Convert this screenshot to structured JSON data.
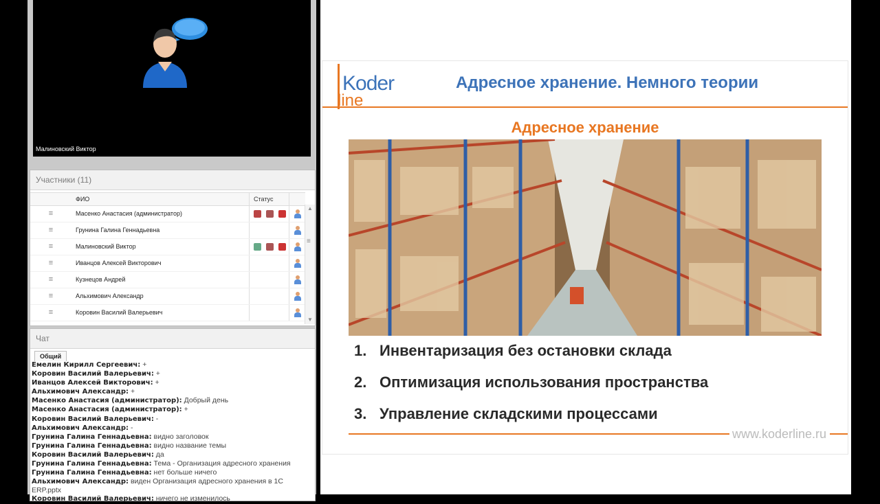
{
  "video": {
    "speaker_name": "Малиновский Виктор"
  },
  "participants": {
    "title": "Участники (11)",
    "columns": {
      "name": "ФИО",
      "status": "Статус"
    },
    "rows": [
      {
        "name": "Масенко Анастасия (администратор)",
        "icons": [
          "hat",
          "mic",
          "cam"
        ]
      },
      {
        "name": "Грунина Галина Геннадьевна",
        "icons": []
      },
      {
        "name": "Малиновский Виктор",
        "icons": [
          "speaker",
          "mic",
          "cam"
        ]
      },
      {
        "name": "Иванцов Алексей Викторович",
        "icons": []
      },
      {
        "name": "Кузнецов Андрей",
        "icons": []
      },
      {
        "name": "Альхимович Александр",
        "icons": []
      },
      {
        "name": "Коровин Василий Валерьевич",
        "icons": []
      }
    ]
  },
  "chat": {
    "title": "Чат",
    "tab": "Общий",
    "messages": [
      {
        "who": "Емелин Кирилл Сергеевич:",
        "text": "+"
      },
      {
        "who": "Коровин Василий Валерьевич:",
        "text": "+"
      },
      {
        "who": "Иванцов Алексей Викторович:",
        "text": "+"
      },
      {
        "who": "Альхимович Александр:",
        "text": "+"
      },
      {
        "who": "Масенко Анастасия (администратор):",
        "text": "Добрый день"
      },
      {
        "who": "Масенко Анастасия (администратор):",
        "text": "+"
      },
      {
        "who": "Коровин Василий Валерьевич:",
        "text": "-"
      },
      {
        "who": "Альхимович Александр:",
        "text": "-"
      },
      {
        "who": "Грунина Галина Геннадьевна:",
        "text": "видно заголовок"
      },
      {
        "who": "Грунина Галина Геннадьевна:",
        "text": "видно название темы"
      },
      {
        "who": "Коровин Василий Валерьевич:",
        "text": "да"
      },
      {
        "who": "Грунина Галина Геннадьевна:",
        "text": "Тема - Организация адресного хранения"
      },
      {
        "who": "Грунина Галина Геннадьевна:",
        "text": "нет больше ничего"
      },
      {
        "who": "Альхимович Александр:",
        "text": "виден Организация адресного хранения в 1С ERP.pptx"
      },
      {
        "who": "Коровин Василий Валерьевич:",
        "text": "ничего не изменилось"
      }
    ]
  },
  "slide": {
    "logo_top": "Koder",
    "logo_bottom": "line",
    "title": "Адресное хранение. Немного теории",
    "subtitle": "Адресное хранение",
    "items": [
      {
        "num": "1.",
        "text": "Инвентаризация без остановки склада"
      },
      {
        "num": "2.",
        "text": "Оптимизация использования пространства"
      },
      {
        "num": "3.",
        "text": "Управление складскими процессами"
      }
    ],
    "footer_url": "www.koderline.ru"
  },
  "colors": {
    "accent_orange": "#e87722",
    "title_blue": "#3d73b8"
  }
}
